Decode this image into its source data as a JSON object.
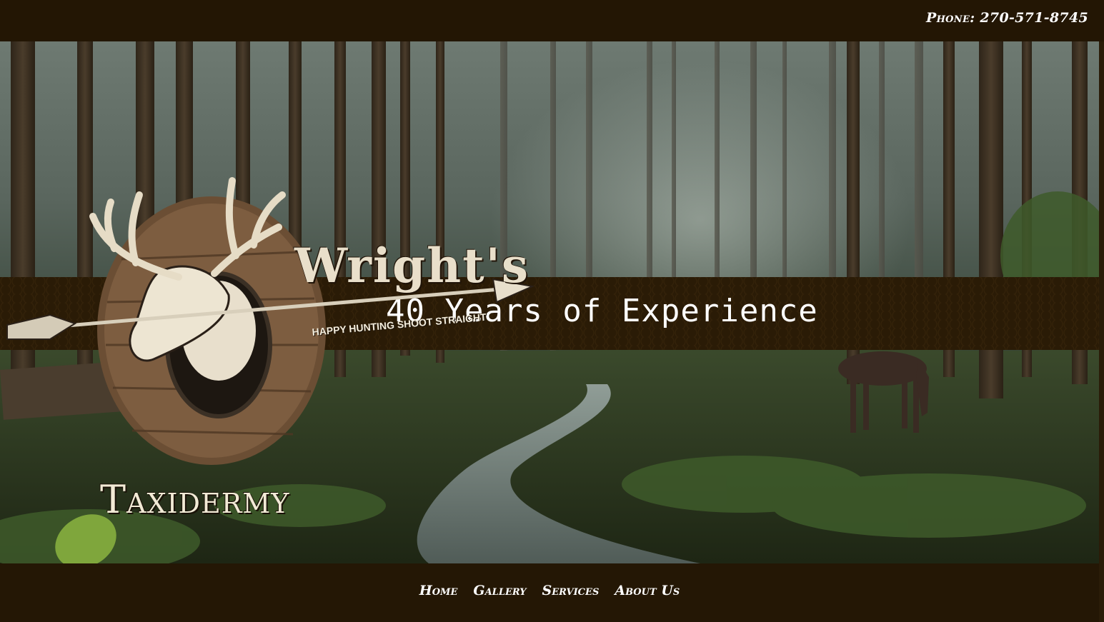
{
  "header": {
    "phone_text": "Phone: 270-571-8745"
  },
  "hero": {
    "banner_text": "40 Years of Experience",
    "logo": {
      "brand": "Wright's",
      "tagline": "HAPPY HUNTING SHOOT STRAIGHT",
      "word": "Taxidermy"
    }
  },
  "nav": {
    "items": [
      {
        "label": "Home"
      },
      {
        "label": "Gallery"
      },
      {
        "label": "Services"
      },
      {
        "label": "About Us"
      }
    ]
  },
  "colors": {
    "bar_background": "#231604",
    "banner_background": "#2a1b06",
    "text": "#ffffff"
  }
}
